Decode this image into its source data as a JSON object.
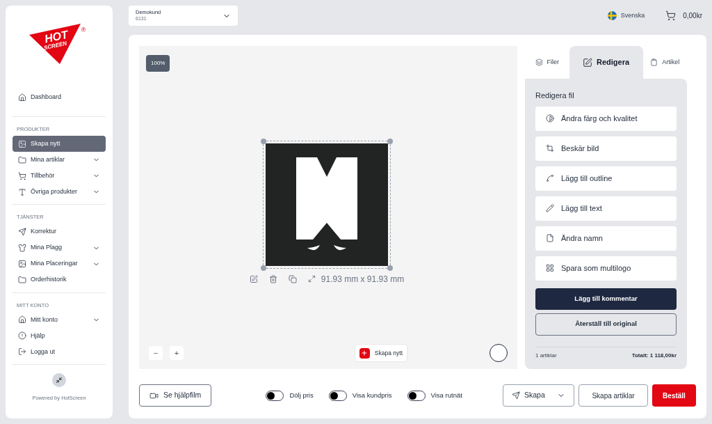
{
  "logo": {
    "top": "HOT",
    "bottom": "SCREEN",
    "mark": "®"
  },
  "sidebar": {
    "groups": [
      {
        "items": [
          {
            "label": "Dashboard",
            "selected": false,
            "expandable": false
          }
        ]
      },
      {
        "heading": "PRODUKTER",
        "items": [
          {
            "label": "Skapa nytt",
            "selected": true,
            "expandable": false
          },
          {
            "label": "Mina artiklar",
            "selected": false,
            "expandable": true
          },
          {
            "label": "Tillbehör",
            "selected": false,
            "expandable": true
          },
          {
            "label": "Övriga produkter",
            "selected": false,
            "expandable": true
          }
        ]
      },
      {
        "heading": "TJÄNSTER",
        "items": [
          {
            "label": "Korrektur",
            "selected": false,
            "expandable": false
          },
          {
            "label": "Mina Plagg",
            "selected": false,
            "expandable": true
          },
          {
            "label": "Mina Placeringar",
            "selected": false,
            "expandable": true
          },
          {
            "label": "Orderhistorik",
            "selected": false,
            "expandable": false
          }
        ]
      },
      {
        "heading": "MITT KONTO",
        "items": [
          {
            "label": "Mitt konto",
            "selected": false,
            "expandable": true
          },
          {
            "label": "Hjälp",
            "selected": false,
            "expandable": false
          },
          {
            "label": "Logga ut",
            "selected": false,
            "expandable": false
          }
        ]
      }
    ],
    "footer": "Powered by HotScreen"
  },
  "customer": {
    "name": "Demokund",
    "number": "6131"
  },
  "language": "Svenska",
  "cart_total": "0,00kr",
  "canvas": {
    "zoom": "100%",
    "dimensions": "91.93 mm x 91.93 mm",
    "zoom_out": "−",
    "zoom_in": "+",
    "create_button": "Skapa nytt"
  },
  "tabs": [
    {
      "label": "Filer",
      "selected": false
    },
    {
      "label": "Redigera",
      "selected": true
    },
    {
      "label": "Artikel",
      "selected": false
    }
  ],
  "panel": {
    "title": "Redigera fil",
    "actions": [
      "Ändra färg och kvalitet",
      "Beskär bild",
      "Lägg till outline",
      "Lägg till text",
      "Ändra namn",
      "Spara som multilogo"
    ],
    "comment_button": "Lägg till kommentar",
    "reset_button": "Återställ till original",
    "article_count": "1 artiklar",
    "total": "Totalt: 1 118,00kr"
  },
  "bottom": {
    "help_button": "Se hjälpfilm",
    "toggles": [
      {
        "label": "Dölj pris",
        "on": false
      },
      {
        "label": "Visa kundpris",
        "on": false
      },
      {
        "label": "Visa rutnät",
        "on": false
      }
    ],
    "create_menu": "Skapa",
    "create_articles": "Skapa artiklar",
    "order_button": "Beställ"
  }
}
